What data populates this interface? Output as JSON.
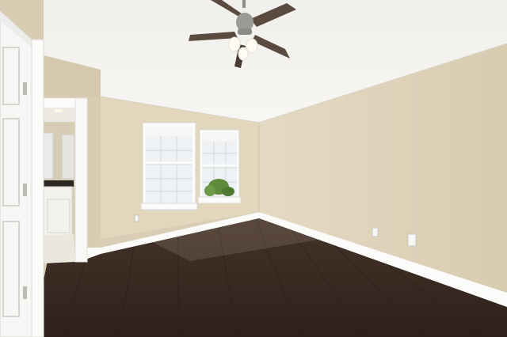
{
  "photo": {
    "subject": "empty-bedroom",
    "colors": {
      "ceiling": "#f3f2ef",
      "wall_left": "#dccfb4",
      "wall_back": "#e3d8c0",
      "wall_right": "#ddd1b8",
      "floor": "#3a2a22",
      "trim": "#fbfbf9",
      "fan_blade": "#5b4a40",
      "fan_metal": "#9a9a96",
      "window_glass": "#eef2f4",
      "greenery": "#5f8a3c"
    }
  }
}
